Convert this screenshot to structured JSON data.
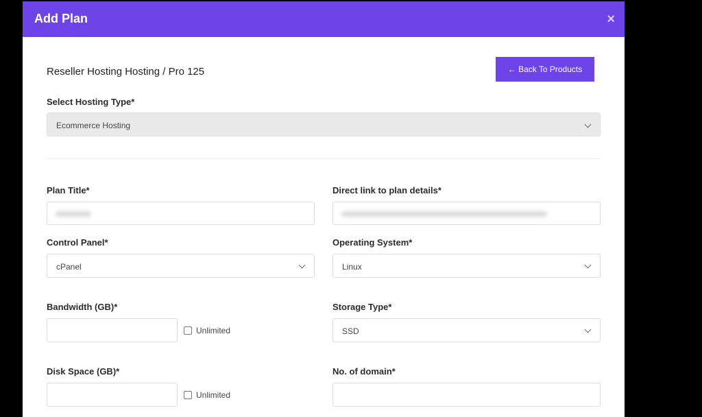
{
  "modal": {
    "title": "Add Plan",
    "close_label": "×",
    "subtitle": "Reseller Hosting Hosting / Pro 125",
    "back_button": "← Back To Products"
  },
  "form": {
    "hosting_type": {
      "label": "Select Hosting Type*",
      "value": "Ecommerce Hosting"
    },
    "plan_title": {
      "label": "Plan Title*",
      "value": ""
    },
    "direct_link": {
      "label": "Direct link to plan details*",
      "value": ""
    },
    "control_panel": {
      "label": "Control Panel*",
      "value": "cPanel"
    },
    "operating_system": {
      "label": "Operating System*",
      "value": "Linux"
    },
    "bandwidth": {
      "label": "Bandwidth (GB)*",
      "value": "",
      "unlimited_label": "Unlimited",
      "unlimited_checked": false
    },
    "storage_type": {
      "label": "Storage Type*",
      "value": "SSD"
    },
    "disk_space": {
      "label": "Disk Space (GB)*",
      "value": "",
      "unlimited_label": "Unlimited",
      "unlimited_checked": false
    },
    "domains": {
      "label": "No. of domain*",
      "value": ""
    }
  },
  "colors": {
    "accent": "#6c44e8"
  },
  "icons": {
    "dropdown": "chevron-down-icon",
    "close": "close-icon"
  }
}
